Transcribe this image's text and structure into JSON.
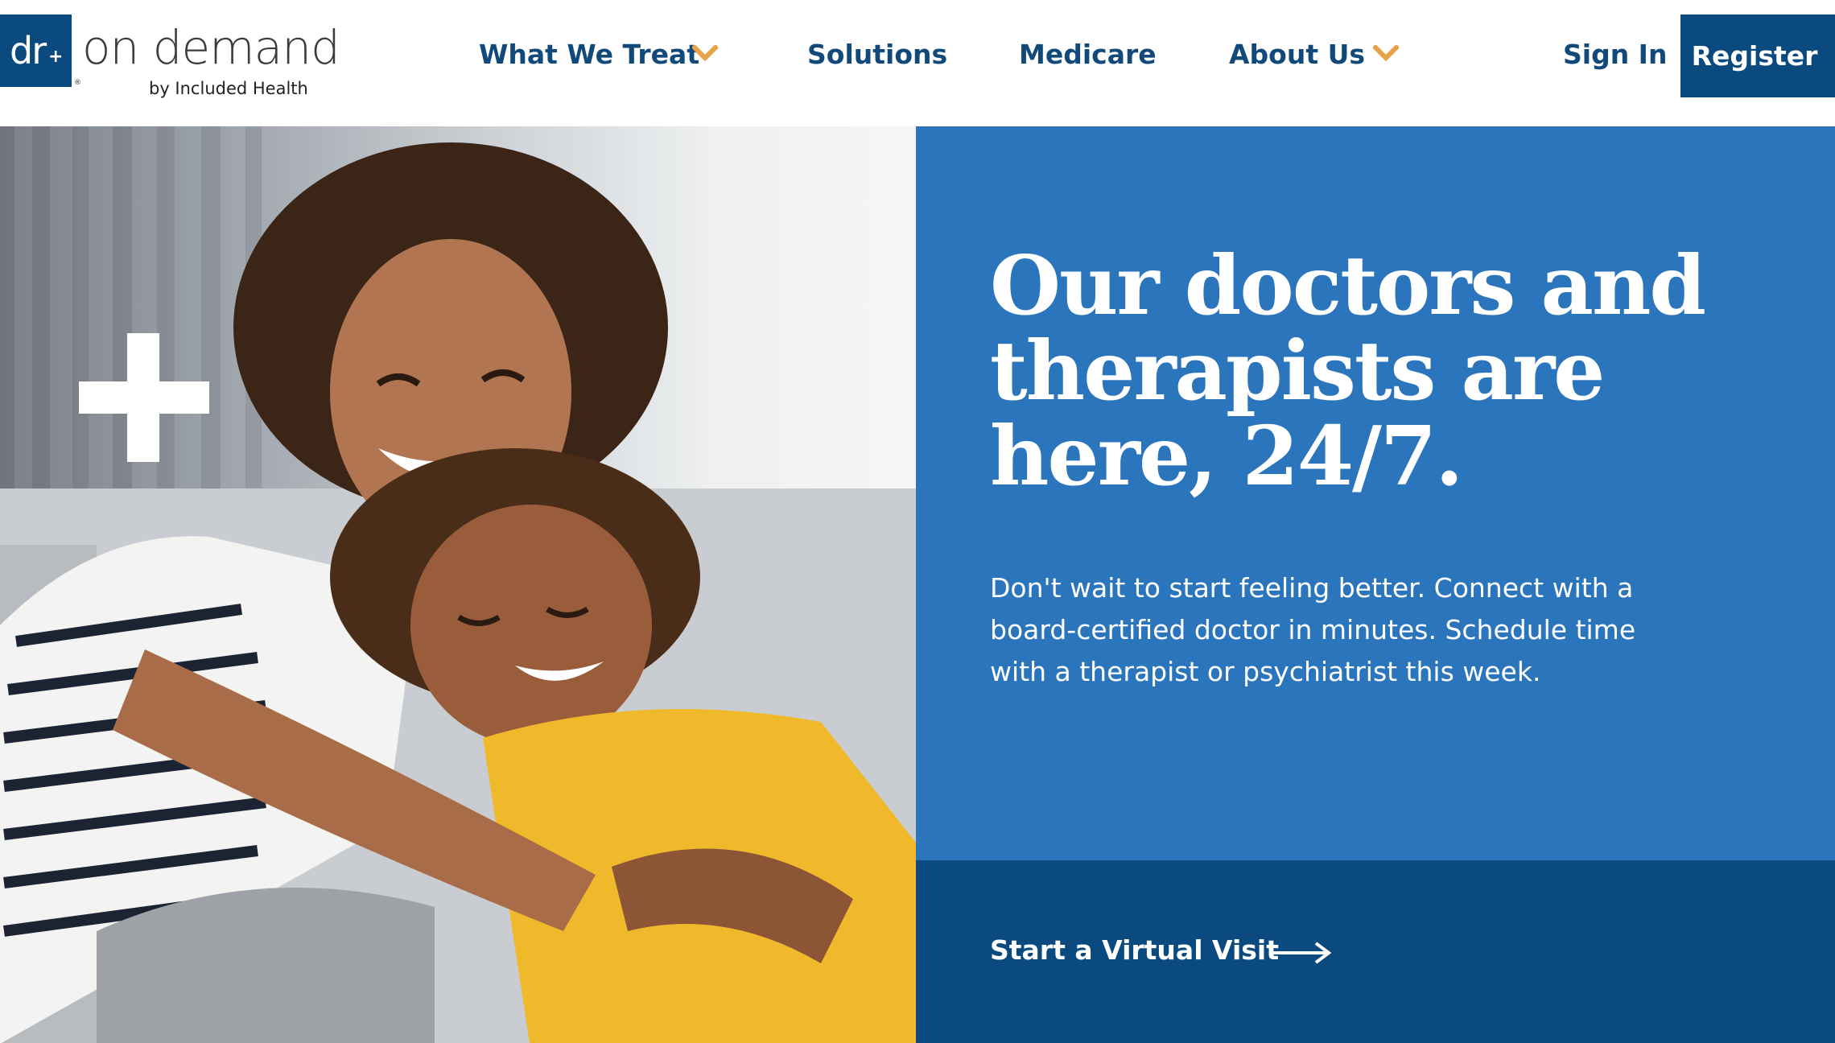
{
  "brand": {
    "logo_mark": "dr",
    "logo_plus": "+",
    "logo_registered": "®",
    "name": "on demand",
    "tagline": "by Included Health",
    "colors": {
      "navy": "#0b4a7e",
      "blue": "#2b75bd",
      "accent_orange": "#e8a24a"
    }
  },
  "nav": {
    "items": [
      {
        "label": "What We Treat",
        "has_dropdown": true,
        "icon": "chevron-down-icon"
      },
      {
        "label": "Solutions",
        "has_dropdown": false
      },
      {
        "label": "Medicare",
        "has_dropdown": false
      },
      {
        "label": "About Us",
        "has_dropdown": true,
        "icon": "chevron-down-icon"
      }
    ],
    "sign_in": "Sign In",
    "register": "Register"
  },
  "hero": {
    "image_icon": "plus-cross-icon",
    "headline": "Our doctors and therapists are here, 24/7.",
    "subtext": "Don't wait to start feeling better. Connect with a board-certified doctor in minutes. Schedule time with a therapist or psychiatrist this week.",
    "cta_label": "Start a Virtual Visit",
    "cta_icon": "arrow-right-icon"
  }
}
